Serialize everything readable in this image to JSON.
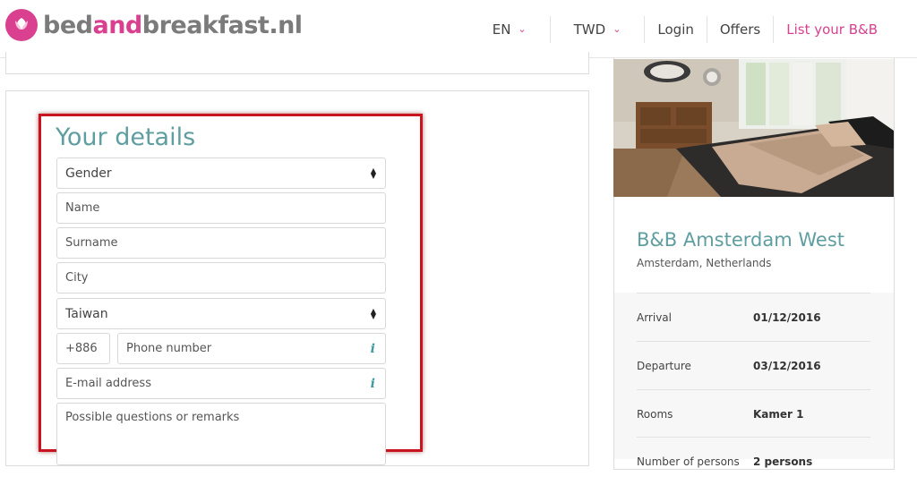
{
  "header": {
    "logo_main": "bed",
    "logo_and": "and",
    "logo_rest": "breakfast",
    "logo_tld": ".nl",
    "nav": {
      "language": "EN",
      "currency": "TWD",
      "login": "Login",
      "offers": "Offers",
      "list_bb": "List your B&B"
    }
  },
  "form": {
    "title": "Your details",
    "gender": "Gender",
    "name_placeholder": "Name",
    "surname_placeholder": "Surname",
    "city_placeholder": "City",
    "country": "Taiwan",
    "phone_code": "+886",
    "phone_placeholder": "Phone number",
    "email_placeholder": "E-mail address",
    "remarks_placeholder": "Possible questions or remarks"
  },
  "property": {
    "name": "B&B Amsterdam West",
    "location": "Amsterdam, Netherlands",
    "rows": [
      {
        "label": "Arrival",
        "value": "01/12/2016"
      },
      {
        "label": "Departure",
        "value": "03/12/2016"
      },
      {
        "label": "Rooms",
        "value": "Kamer 1"
      },
      {
        "label": "Number of persons",
        "value": "2 persons"
      }
    ]
  },
  "colors": {
    "brand_pink": "#d9408f",
    "teal": "#5f9ea0",
    "highlight_red": "#c8141e"
  }
}
